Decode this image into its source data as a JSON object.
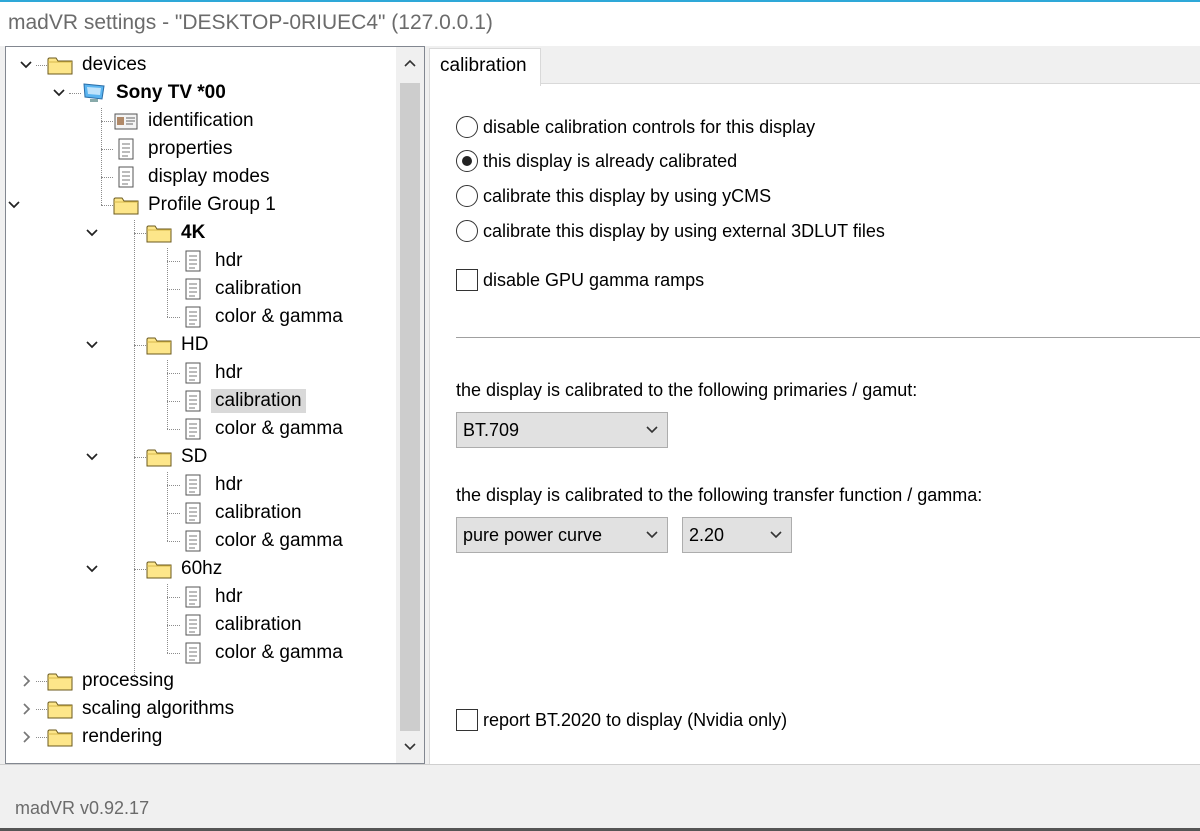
{
  "window": {
    "title": "madVR settings - \"DESKTOP-0RIUEC4\" (127.0.0.1)"
  },
  "tree": {
    "devices": "devices",
    "sony_tv": "Sony TV *00",
    "identification": "identification",
    "properties": "properties",
    "display_modes": "display modes",
    "profile_group": "Profile Group 1",
    "groups": [
      {
        "label": "4K",
        "items": [
          "hdr",
          "calibration",
          "color & gamma"
        ]
      },
      {
        "label": "HD",
        "items": [
          "hdr",
          "calibration",
          "color & gamma"
        ]
      },
      {
        "label": "SD",
        "items": [
          "hdr",
          "calibration",
          "color & gamma"
        ]
      },
      {
        "label": "60hz",
        "items": [
          "hdr",
          "calibration",
          "color & gamma"
        ]
      }
    ],
    "processing": "processing",
    "scaling": "scaling algorithms",
    "rendering": "rendering"
  },
  "tab": {
    "label": "calibration"
  },
  "calibration": {
    "radios": [
      {
        "label": "disable calibration controls for this display",
        "checked": false
      },
      {
        "label": "this display is already calibrated",
        "checked": true
      },
      {
        "label": "calibrate this display by using yCMS",
        "checked": false
      },
      {
        "label": "calibrate this display by using external 3DLUT files",
        "checked": false
      }
    ],
    "gpu_gamma": {
      "label": "disable GPU gamma ramps",
      "checked": false
    },
    "primaries_label": "the display is calibrated to the following primaries / gamut:",
    "primaries_value": "BT.709",
    "transfer_label": "the display is calibrated to the following transfer function / gamma:",
    "transfer_value": "pure power curve",
    "gamma_value": "2.20",
    "report_bt2020": {
      "label": "report BT.2020 to display  (Nvidia only)",
      "checked": false
    }
  },
  "status": {
    "version": "madVR v0.92.17"
  },
  "colors": {
    "accent": "#2ea8d8",
    "selection": "#d9d9d9",
    "folder": "#fde68a"
  }
}
